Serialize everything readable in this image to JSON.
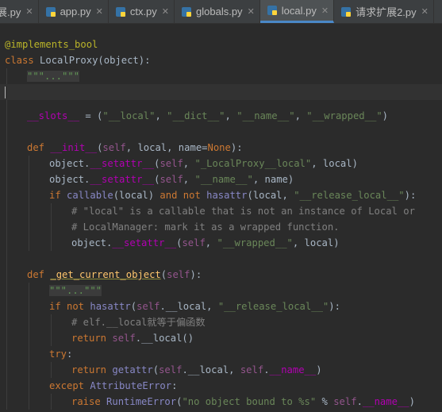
{
  "tabs": [
    {
      "label": "展.py",
      "active": false
    },
    {
      "label": "app.py",
      "active": false
    },
    {
      "label": "ctx.py",
      "active": false
    },
    {
      "label": "globals.py",
      "active": false
    },
    {
      "label": "local.py",
      "active": true
    },
    {
      "label": "请求扩展2.py",
      "active": false
    }
  ],
  "code": {
    "l1": "@implements_bool",
    "l2": {
      "kw": "class ",
      "name": "LocalProxy",
      "rest": "(object):"
    },
    "l3": "\"\"\"...\"\"\"",
    "l5": {
      "slots": "__slots__",
      "eq": " = (",
      "s1": "\"__local\"",
      "c1": ", ",
      "s2": "\"__dict__\"",
      "c2": ", ",
      "s3": "\"__name__\"",
      "c3": ", ",
      "s4": "\"__wrapped__\"",
      "end": ")"
    },
    "l7": {
      "kw": "def ",
      "name": "__init__",
      "p1": "(",
      "self": "self",
      "p2": ", local, name=",
      "none": "None",
      "p3": "):"
    },
    "l8": {
      "a": "object.",
      "m": "__setattr__",
      "b": "(",
      "self": "self",
      "c": ", ",
      "s": "\"_LocalProxy__local\"",
      "d": ", local)"
    },
    "l9": {
      "a": "object.",
      "m": "__setattr__",
      "b": "(",
      "self": "self",
      "c": ", ",
      "s": "\"__name__\"",
      "d": ", name)"
    },
    "l10": {
      "kw": "if ",
      "fn": "callable",
      "a": "(local) ",
      "and": "and not ",
      "fn2": "hasattr",
      "b": "(local, ",
      "s": "\"__release_local__\"",
      "c": "):"
    },
    "l11": "# \"local\" is a callable that is not an instance of Local or",
    "l12": "# LocalManager: mark it as a wrapped function.",
    "l13": {
      "a": "object.",
      "m": "__setattr__",
      "b": "(",
      "self": "self",
      "c": ", ",
      "s": "\"__wrapped__\"",
      "d": ", local)"
    },
    "l15": {
      "kw": "def ",
      "name": "_get_current_object",
      "a": "(",
      "self": "self",
      "b": "):"
    },
    "l16": "\"\"\"...\"\"\"",
    "l17": {
      "kw": "if not ",
      "fn": "hasattr",
      "a": "(",
      "self": "self",
      "b": ".__local, ",
      "s": "\"__release_local__\"",
      "c": "):"
    },
    "l18": "# elf.__local就等于偏函数",
    "l19": {
      "kw": "return ",
      "self": "self",
      "a": ".__local()"
    },
    "l20": {
      "kw": "try",
      "a": ":"
    },
    "l21": {
      "kw": "return ",
      "fn": "getattr",
      "a": "(",
      "self": "self",
      "b": ".__local, ",
      "self2": "self",
      "c": ".",
      "m": "__name__",
      "d": ")"
    },
    "l22": {
      "kw": "except ",
      "cls": "AttributeError",
      "a": ":"
    },
    "l23": {
      "kw": "raise ",
      "cls": "RuntimeError",
      "a": "(",
      "s": "\"no object bound to %s\"",
      "b": " % ",
      "self": "self",
      "c": ".",
      "m": "__name__",
      "d": ")"
    }
  }
}
